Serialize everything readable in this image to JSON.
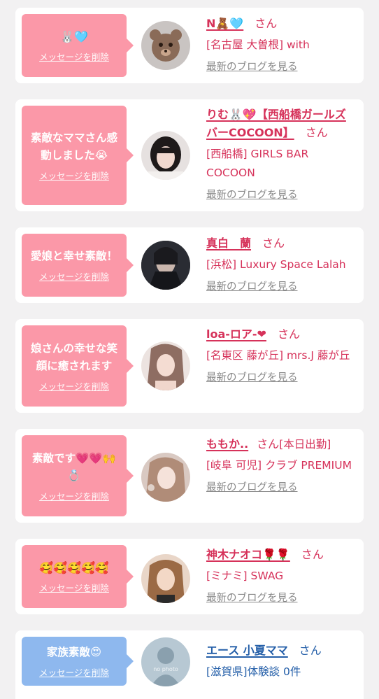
{
  "delete_label": "メッセージを削除",
  "blog_label": "最新のブログを見る",
  "suffix": "さん",
  "cards": [
    {
      "message": "🐰🩵",
      "name": "N🧸🩵",
      "shop": "[名古屋 大曽根] with"
    },
    {
      "message": "素敵なママさん感動しました😭",
      "name": "りむ🐰💖【西船橋ガールズバーCOCOON】",
      "shop": "[西船橋] GIRLS BAR COCOON"
    },
    {
      "message": "愛娘と幸せ素敵！",
      "name": "真白　蘭",
      "shop": "[浜松] Luxury Space Lalah"
    },
    {
      "message": "娘さんの幸せな笑顔に癒されます",
      "name": "loa-ロア-❤",
      "shop": "[名東区 藤が丘] mrs.J 藤が丘"
    },
    {
      "message": "素敵です💗💗🙌💍",
      "name": "ももか..",
      "shop_prefix": "[本日出勤]",
      "shop": "[岐阜 可児] クラブ PREMIUM"
    },
    {
      "message": "🥰🥰🥰🥰🥰",
      "name": "神木ナオコ🌹🌹",
      "shop": "[ミナミ] SWAG"
    },
    {
      "message": "家族素敵😍",
      "name": "エース 小夏ママ",
      "shop": "[滋賀県]体験談 0件",
      "avatar_text": "no photo"
    }
  ],
  "colors": {
    "pink_bubble": "#fb98a8",
    "blue_bubble": "#8eb8ee",
    "pink_text": "#d6325a",
    "blue_text": "#235ea8",
    "gray_link": "#8a8a8a"
  }
}
